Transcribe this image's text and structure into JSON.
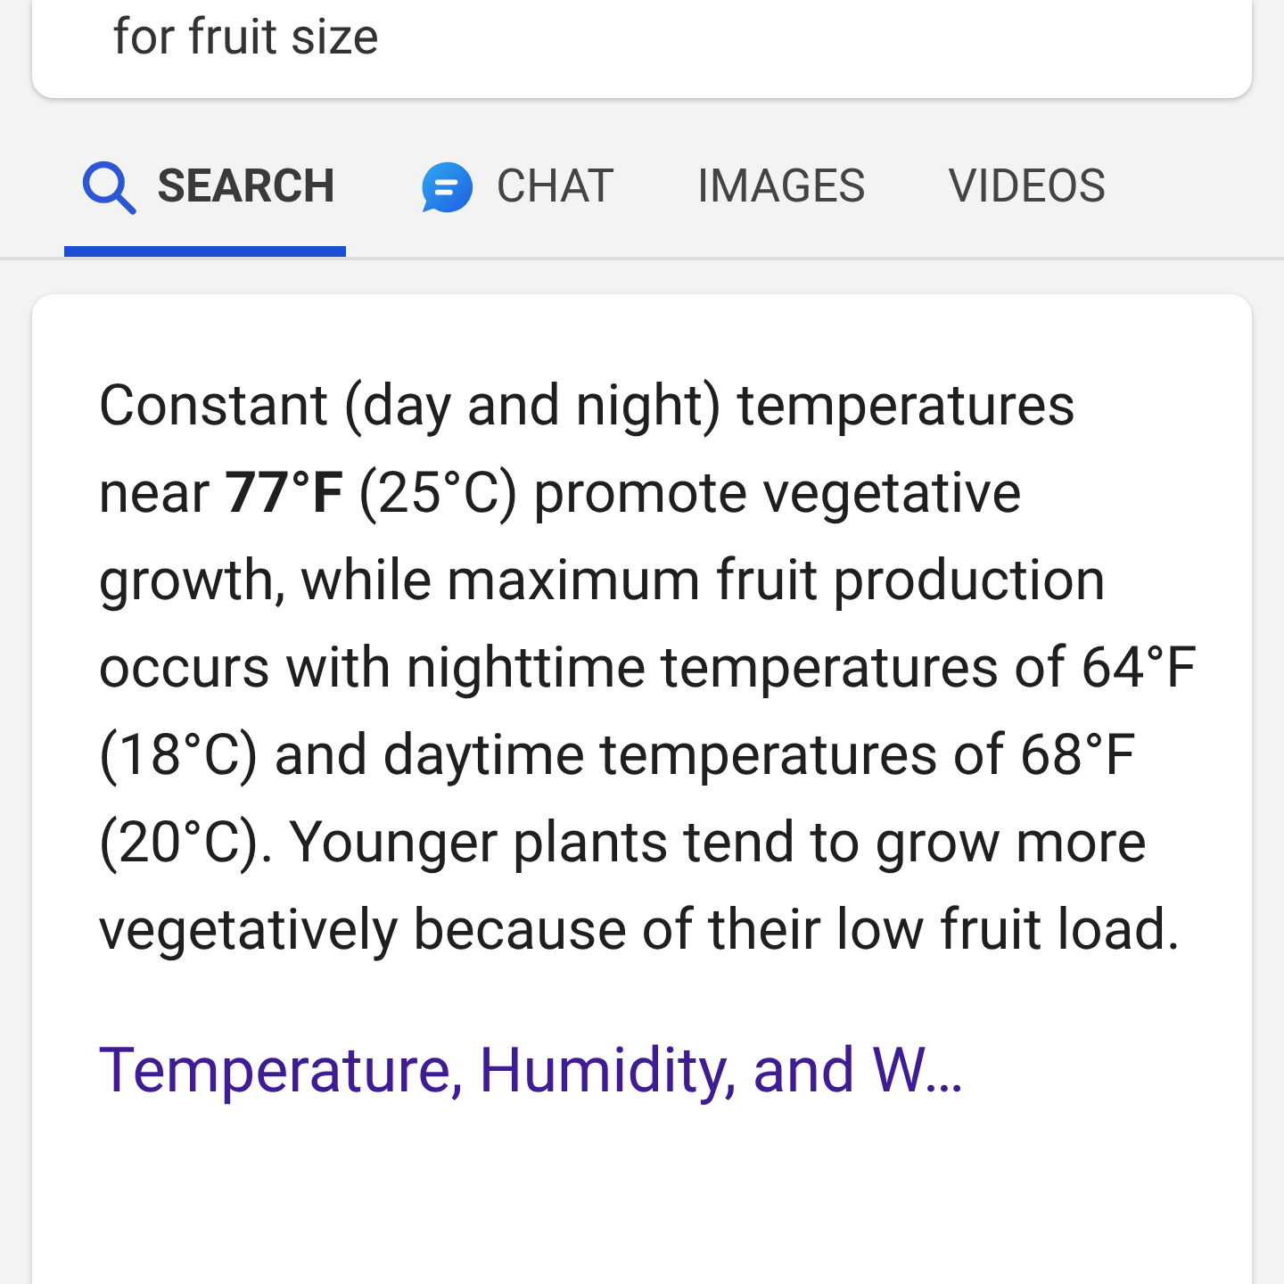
{
  "query_card": {
    "text": "for fruit size"
  },
  "tabs": [
    {
      "label": "SEARCH",
      "kind": "search",
      "selected": true
    },
    {
      "label": "CHAT",
      "kind": "chat",
      "selected": false
    },
    {
      "label": "IMAGES",
      "kind": "plain",
      "selected": false
    },
    {
      "label": "VIDEOS",
      "kind": "plain",
      "selected": false
    }
  ],
  "answer": {
    "text": "Constant (day and night) temperatures near **77°F** (25°C) promote vegetative growth, while maximum fruit production occurs with nighttime temperatures of 64°F (18°C) and daytime temperatures of 68°F (20°C). Younger plants tend to grow more vegetatively because of their low fruit load.",
    "link": "Temperature, Humidity, and W…"
  }
}
